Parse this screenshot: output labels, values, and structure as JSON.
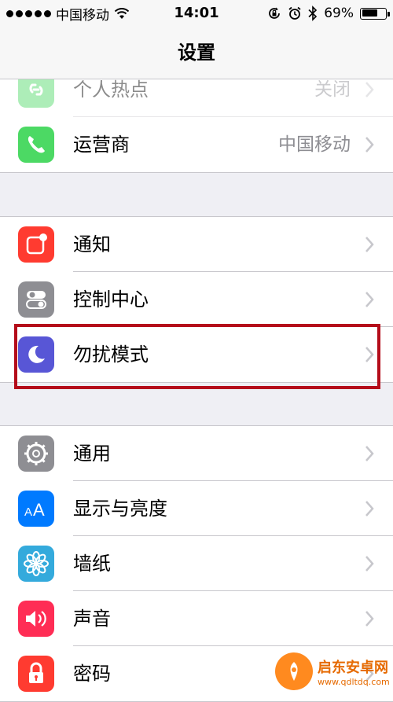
{
  "status_bar": {
    "carrier": "中国移动",
    "time": "14:01",
    "battery_percent": "69%",
    "battery_level": 0.69
  },
  "nav": {
    "title": "设置"
  },
  "groups": [
    {
      "rows": [
        {
          "label": "个人热点",
          "value": "关闭",
          "icon": "personal-hotspot-icon",
          "color": "#4cd964"
        },
        {
          "label": "运营商",
          "value": "中国移动",
          "icon": "phone-icon",
          "color": "#4cd964"
        }
      ]
    },
    {
      "rows": [
        {
          "label": "通知",
          "icon": "notifications-icon",
          "color": "#ff3b30"
        },
        {
          "label": "控制中心",
          "icon": "control-center-icon",
          "color": "#8e8e93"
        },
        {
          "label": "勿扰模式",
          "icon": "moon-icon",
          "color": "#5856d6",
          "highlighted": true
        }
      ]
    },
    {
      "rows": [
        {
          "label": "通用",
          "icon": "gear-icon",
          "color": "#8e8e93"
        },
        {
          "label": "显示与亮度",
          "icon": "display-brightness-icon",
          "color": "#007aff"
        },
        {
          "label": "墙纸",
          "icon": "wallpaper-icon",
          "color": "#34aadc"
        },
        {
          "label": "声音",
          "icon": "sound-icon",
          "color": "#ff2d55"
        },
        {
          "label": "密码",
          "icon": "passcode-icon",
          "color": "#ff3b30"
        }
      ]
    }
  ],
  "watermark": {
    "title": "启东安卓网",
    "url": "www.qdltdq.com"
  }
}
